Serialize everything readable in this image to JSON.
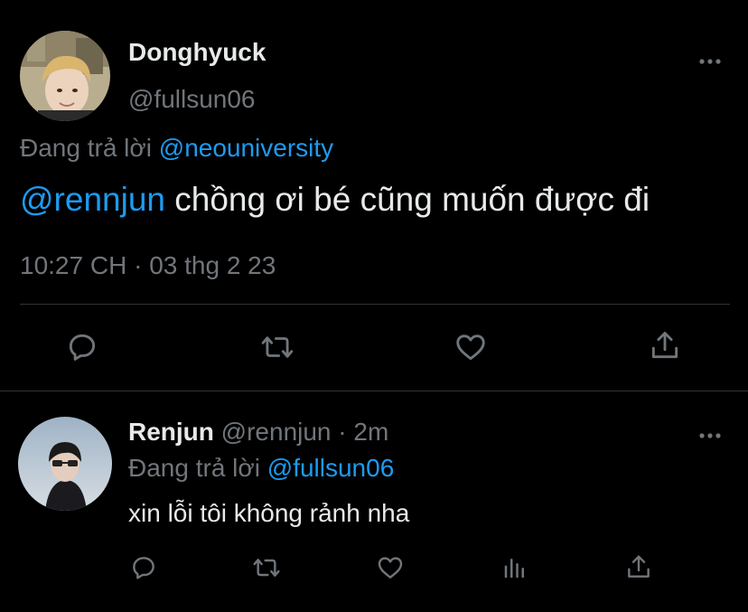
{
  "colors": {
    "background": "#000000",
    "text": "#e7e9ea",
    "muted": "#71767b",
    "link": "#1d9bf0",
    "divider": "#2f3336"
  },
  "main_tweet": {
    "display_name": "Donghyuck",
    "handle": "@fullsun06",
    "replying_prefix": "Đang trả lời",
    "replying_to": "@neouniversity",
    "mention": "@rennjun",
    "text": " chồng ơi bé cũng muốn được đi",
    "time": "10:27 CH",
    "separator": " · ",
    "date": "03 thg 2 23",
    "avatar_icon": "user-avatar",
    "more_icon": "more-horizontal-icon",
    "actions": [
      {
        "icon": "reply-icon"
      },
      {
        "icon": "retweet-icon"
      },
      {
        "icon": "like-icon"
      },
      {
        "icon": "share-icon"
      }
    ]
  },
  "reply_tweet": {
    "display_name": "Renjun",
    "handle": "@rennjun",
    "separator": " · ",
    "time_ago": "2m",
    "replying_prefix": "Đang trả lời",
    "replying_to": "@fullsun06",
    "text": "xin lỗi tôi không rảnh nha",
    "avatar_icon": "user-avatar",
    "more_icon": "more-horizontal-icon",
    "actions": [
      {
        "icon": "reply-icon"
      },
      {
        "icon": "retweet-icon"
      },
      {
        "icon": "like-icon"
      },
      {
        "icon": "analytics-icon"
      },
      {
        "icon": "share-icon"
      }
    ]
  }
}
